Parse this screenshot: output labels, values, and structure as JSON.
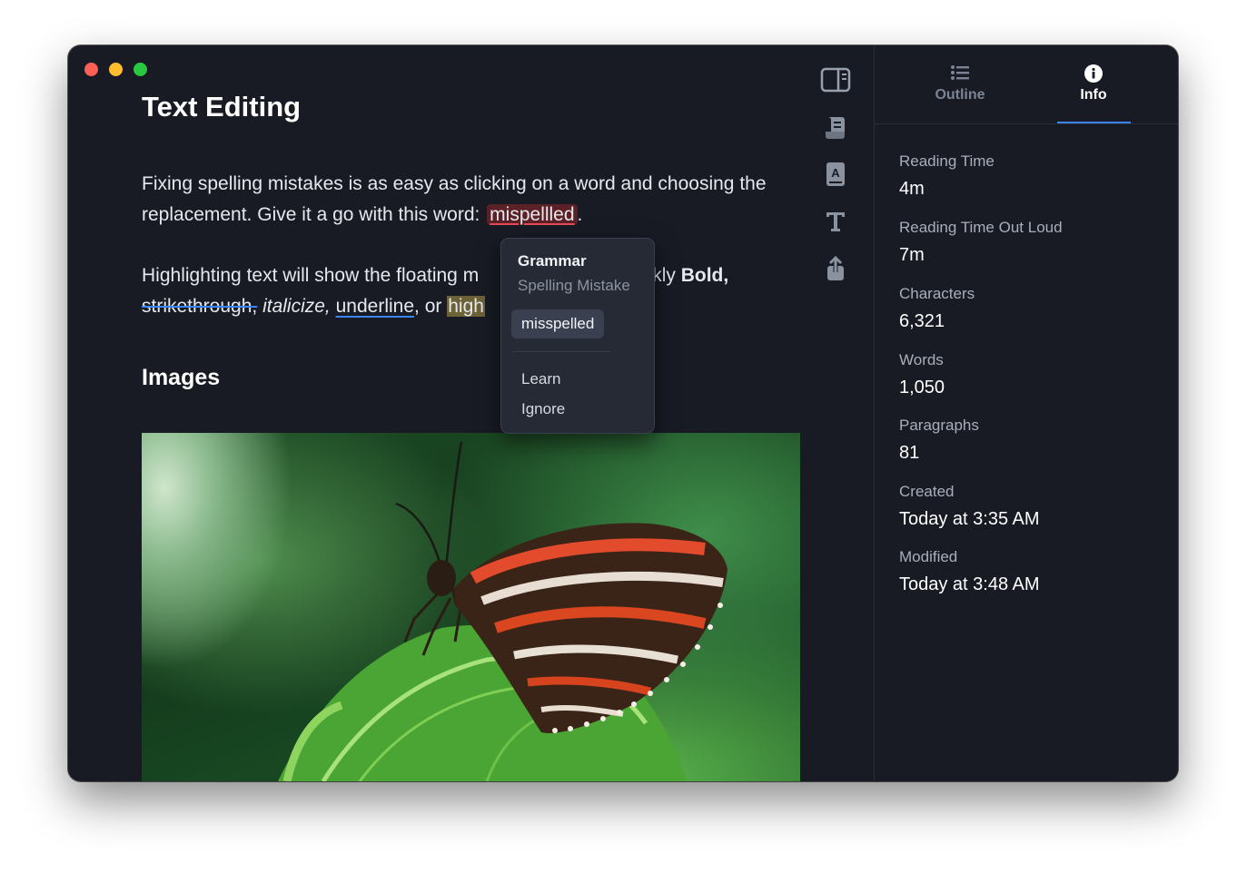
{
  "window": {
    "controls": [
      "close",
      "minimize",
      "maximize"
    ],
    "colors": {
      "close": "#fe5f57",
      "minimize": "#febc2e",
      "maximize": "#28c840"
    }
  },
  "document": {
    "title": "Text Editing",
    "paragraph1": {
      "text_a": "Fixing spelling mistakes is as easy as clicking on a word and choosing the",
      "text_b": "replacement. Give it a go with this word: ",
      "misspelled_word": "mispellled",
      "text_c": "."
    },
    "paragraph2": {
      "line1_start": "Highlighting text will show the floating m",
      "line1_end": "u quickly ",
      "bold_word": "Bold,",
      "strike_word": "strikethrough,",
      "italic_word": "italicize,",
      "underline_word": "underline",
      "connector": ", or ",
      "highlight_fragment": "high"
    },
    "heading_images": "Images",
    "image": {
      "subject": "butterfly-on-leaf"
    }
  },
  "toolbar": {
    "icons": [
      "sidebar-toggle-icon",
      "scroll-icon",
      "dictionary-icon",
      "typography-icon",
      "share-icon"
    ]
  },
  "spelling_popover": {
    "title": "Grammar",
    "subtitle": "Spelling Mistake",
    "suggestion": "misspelled",
    "actions": [
      "Learn",
      "Ignore"
    ]
  },
  "sidebar": {
    "tabs": [
      {
        "label": "Outline",
        "icon": "list-icon",
        "active": false
      },
      {
        "label": "Info",
        "icon": "info-icon",
        "active": true
      }
    ],
    "stats": [
      {
        "label": "Reading Time",
        "value": "4m"
      },
      {
        "label": "Reading Time Out Loud",
        "value": "7m"
      },
      {
        "label": "Characters",
        "value": "6,321"
      },
      {
        "label": "Words",
        "value": "1,050"
      },
      {
        "label": "Paragraphs",
        "value": "81"
      },
      {
        "label": "Created",
        "value": "Today at 3:35 AM"
      },
      {
        "label": "Modified",
        "value": "Today at 3:48 AM"
      }
    ]
  },
  "colors": {
    "accent": "#3b86f5",
    "error": "#e54b57",
    "background": "#181b24"
  }
}
